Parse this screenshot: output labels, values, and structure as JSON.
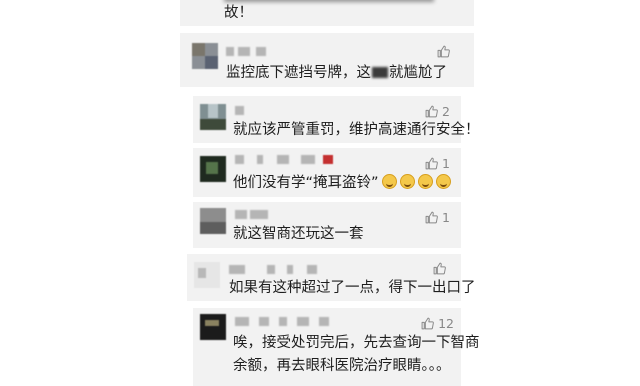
{
  "comments": [
    {
      "text": "故！",
      "likes": ""
    },
    {
      "text_before": "监控底下遮挡号牌，这",
      "text_after": "就尴尬了",
      "likes": ""
    },
    {
      "text": "就应该严管重罚，维护高速通行安全！",
      "likes": "2"
    },
    {
      "text": "他们没有学“掩耳盗铃”",
      "likes": "1",
      "emoji": "grinning-squint-face",
      "emoji_count": 4
    },
    {
      "text": "就这智商还玩这一套",
      "likes": "1"
    },
    {
      "text": "如果有这种超过了一点，得下一出口了",
      "likes": ""
    },
    {
      "text_line1": "唉，接受处罚完后，先去查询一下智商",
      "text_line2": "余额，再去眼科医院治疗眼睛。。。",
      "likes": "12"
    }
  ],
  "icons": {
    "like": "thumbs-up-icon"
  },
  "colors": {
    "card_bg": "#f2f2f2",
    "text": "#1e1e1e",
    "meta": "#888888"
  }
}
